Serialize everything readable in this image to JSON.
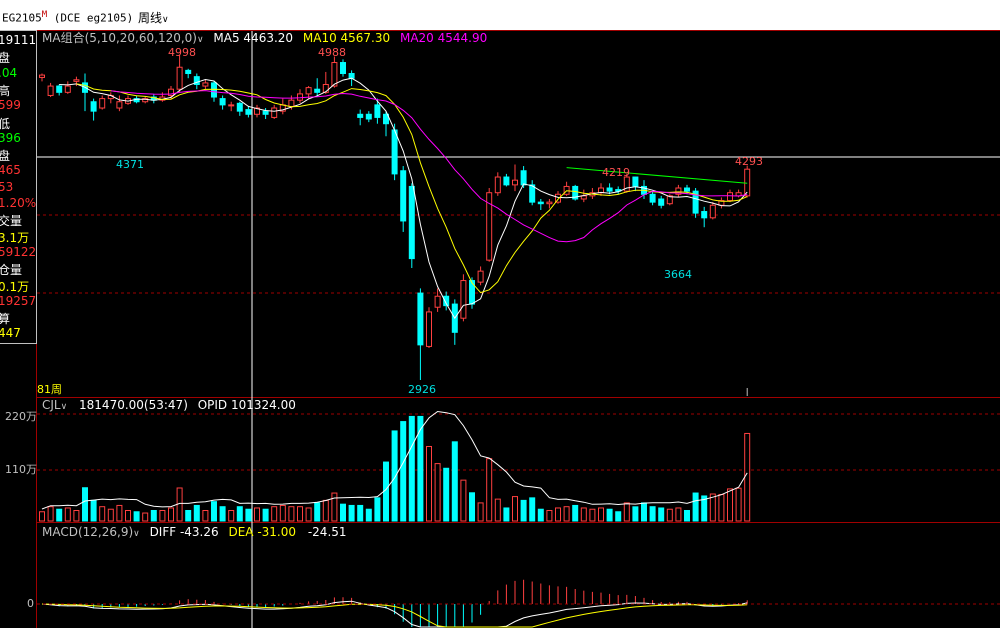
{
  "header": {
    "symbol": "EG2105",
    "symbol_mark": "M",
    "exchange_code": "(DCE eg2105)",
    "period_label": "周线",
    "period_arrow": "∨"
  },
  "info_panel": [
    {
      "text": "191115",
      "color": "#ffffff"
    },
    {
      "text": "盘",
      "color": "#ffffff"
    },
    {
      "text": ".04",
      "color": "#00ff00"
    },
    {
      "text": "高",
      "color": "#ffffff"
    },
    {
      "text": "599",
      "color": "#ff3333"
    },
    {
      "text": "低",
      "color": "#ffffff"
    },
    {
      "text": "396",
      "color": "#00ff00"
    },
    {
      "text": "盘",
      "color": "#ffffff"
    },
    {
      "text": "465",
      "color": "#ff3333"
    },
    {
      "text": "53",
      "color": "#ff3333"
    },
    {
      "text": "1.20%",
      "color": "#ff3333"
    },
    {
      "text": "交量",
      "color": "#ffffff"
    },
    {
      "text": "3.1万",
      "color": "#ffff00"
    },
    {
      "text": "59122",
      "color": "#ff3333"
    },
    {
      "text": "仓量",
      "color": "#ffffff"
    },
    {
      "text": "0.1万",
      "color": "#ffff00"
    },
    {
      "text": "19257",
      "color": "#ff3333"
    },
    {
      "text": "算",
      "color": "#ffffff"
    },
    {
      "text": "447",
      "color": "#ffff00"
    }
  ],
  "main_legend": {
    "name": "MA组合(5,10,20,60,120,0)",
    "ma5": "MA5 4463.20",
    "ma10": "MA10 4567.30",
    "ma20": "MA20 4544.90"
  },
  "price_labels": {
    "high1": "4998",
    "high2": "4988",
    "low1": "4371",
    "high3": "4219",
    "high4": "4293",
    "low2": "3664",
    "low3": "2926",
    "bar_count": "81周"
  },
  "volume_panel": {
    "name": "CJL",
    "arrow": "∨",
    "value": "181470.00(53:47)",
    "opid": "OPID 101324.00",
    "axis_high": "220万",
    "axis_mid": "110万"
  },
  "macd_panel": {
    "name": "MACD(12,26,9)",
    "arrow": "∨",
    "diff": "DIFF -43.26",
    "dea": "DEA -31.00",
    "macd": "-24.51",
    "axis_zero": "0"
  },
  "chart_data": {
    "type": "candlestick",
    "candles": [
      [
        4855,
        4870,
        4830,
        4880
      ],
      [
        4740,
        4800,
        4730,
        4820
      ],
      [
        4800,
        4760,
        4740,
        4810
      ],
      [
        4760,
        4800,
        4750,
        4830
      ],
      [
        4830,
        4840,
        4800,
        4860
      ],
      [
        4820,
        4760,
        4640,
        4880
      ],
      [
        4700,
        4640,
        4580,
        4720
      ],
      [
        4660,
        4720,
        4650,
        4740
      ],
      [
        4720,
        4740,
        4690,
        4760
      ],
      [
        4660,
        4700,
        4640,
        4740
      ],
      [
        4690,
        4720,
        4680,
        4740
      ],
      [
        4720,
        4700,
        4690,
        4740
      ],
      [
        4700,
        4720,
        4690,
        4730
      ],
      [
        4730,
        4710,
        4690,
        4750
      ],
      [
        4710,
        4730,
        4700,
        4760
      ],
      [
        4740,
        4780,
        4720,
        4800
      ],
      [
        4780,
        4920,
        4760,
        4998
      ],
      [
        4900,
        4880,
        4850,
        4910
      ],
      [
        4860,
        4810,
        4780,
        4880
      ],
      [
        4800,
        4820,
        4780,
        4840
      ],
      [
        4820,
        4730,
        4700,
        4830
      ],
      [
        4720,
        4680,
        4650,
        4740
      ],
      [
        4680,
        4680,
        4640,
        4700
      ],
      [
        4690,
        4640,
        4610,
        4700
      ],
      [
        4650,
        4620,
        4600,
        4670
      ],
      [
        4620,
        4660,
        4600,
        4680
      ],
      [
        4640,
        4620,
        4590,
        4660
      ],
      [
        4600,
        4660,
        4590,
        4680
      ],
      [
        4640,
        4680,
        4620,
        4720
      ],
      [
        4670,
        4710,
        4650,
        4740
      ],
      [
        4710,
        4750,
        4690,
        4780
      ],
      [
        4750,
        4790,
        4720,
        4800
      ],
      [
        4780,
        4760,
        4730,
        4850
      ],
      [
        4760,
        4810,
        4750,
        4890
      ],
      [
        4800,
        4950,
        4790,
        4988
      ],
      [
        4950,
        4880,
        4860,
        4970
      ],
      [
        4880,
        4850,
        4800,
        4900
      ],
      [
        4620,
        4600,
        4550,
        4650
      ],
      [
        4620,
        4590,
        4570,
        4640
      ],
      [
        4680,
        4600,
        4560,
        4720
      ],
      [
        4620,
        4560,
        4480,
        4640
      ],
      [
        4520,
        4240,
        4200,
        4560
      ],
      [
        4260,
        3940,
        3870,
        4290
      ],
      [
        4160,
        3700,
        3640,
        4180
      ],
      [
        3480,
        3150,
        2926,
        3510
      ],
      [
        3140,
        3360,
        3130,
        3390
      ],
      [
        3390,
        3460,
        3360,
        3510
      ],
      [
        3460,
        3400,
        3370,
        3490
      ],
      [
        3410,
        3230,
        3150,
        3440
      ],
      [
        3320,
        3560,
        3300,
        3600
      ],
      [
        3560,
        3410,
        3380,
        3580
      ],
      [
        3550,
        3620,
        3530,
        3650
      ],
      [
        3690,
        4120,
        3680,
        4150
      ],
      [
        4120,
        4220,
        4100,
        4250
      ],
      [
        4220,
        4170,
        4160,
        4240
      ],
      [
        4170,
        4200,
        4130,
        4300
      ],
      [
        4260,
        4170,
        4150,
        4290
      ],
      [
        4170,
        4060,
        4040,
        4200
      ],
      [
        4060,
        4050,
        4010,
        4080
      ],
      [
        4050,
        4060,
        4020,
        4080
      ],
      [
        4060,
        4110,
        4050,
        4130
      ],
      [
        4110,
        4160,
        4100,
        4190
      ],
      [
        4160,
        4080,
        4070,
        4170
      ],
      [
        4080,
        4100,
        4060,
        4140
      ],
      [
        4100,
        4120,
        4080,
        4150
      ],
      [
        4120,
        4150,
        4100,
        4180
      ],
      [
        4150,
        4130,
        4110,
        4180
      ],
      [
        4140,
        4130,
        4110,
        4160
      ],
      [
        4130,
        4220,
        4120,
        4240
      ],
      [
        4220,
        4160,
        4130,
        4219
      ],
      [
        4160,
        4110,
        4080,
        4200
      ],
      [
        4110,
        4060,
        4040,
        4130
      ],
      [
        4080,
        4040,
        4020,
        4100
      ],
      [
        4050,
        4100,
        4040,
        4110
      ],
      [
        4110,
        4150,
        4090,
        4170
      ],
      [
        4150,
        4130,
        4110,
        4170
      ],
      [
        4130,
        3990,
        3960,
        4150
      ],
      [
        4000,
        3960,
        3900,
        4030
      ],
      [
        3960,
        4040,
        3950,
        4060
      ],
      [
        4040,
        4070,
        4020,
        4090
      ],
      [
        4070,
        4120,
        4060,
        4140
      ],
      [
        4100,
        4120,
        4090,
        4140
      ],
      [
        4100,
        4270,
        4090,
        4293
      ]
    ]
  }
}
